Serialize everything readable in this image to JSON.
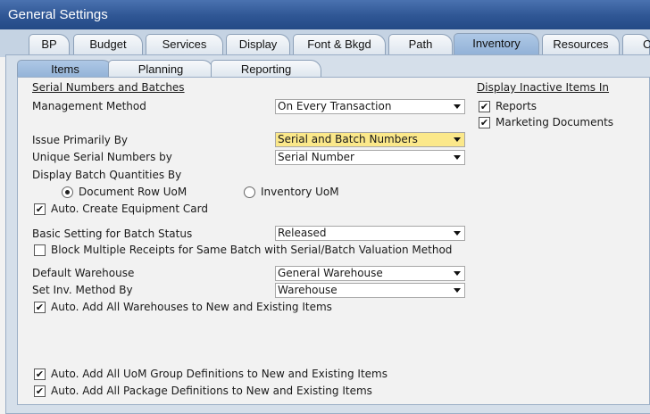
{
  "window": {
    "title": "General Settings"
  },
  "main_tabs": [
    {
      "label": "BP"
    },
    {
      "label": "Budget"
    },
    {
      "label": "Services"
    },
    {
      "label": "Display"
    },
    {
      "label": "Font & Bkgd"
    },
    {
      "label": "Path"
    },
    {
      "label": "Inventory"
    },
    {
      "label": "Resources"
    },
    {
      "label": "Ca"
    }
  ],
  "active_main_tab": "Inventory",
  "sub_tabs": [
    {
      "label": "Items"
    },
    {
      "label": "Planning"
    },
    {
      "label": "Reporting"
    }
  ],
  "active_sub_tab": "Items",
  "serial": {
    "section_title": "Serial Numbers and Batches",
    "management_method": {
      "label": "Management Method",
      "value": "On Every Transaction"
    },
    "issue_primarily_by": {
      "label": "Issue Primarily By",
      "value": "Serial and Batch Numbers"
    },
    "unique_serial_by": {
      "label": "Unique Serial Numbers by",
      "value": "Serial Number"
    },
    "display_batch_qty": {
      "label": "Display Batch Quantities By",
      "options": [
        {
          "label": "Document Row UoM",
          "selected": true
        },
        {
          "label": "Inventory UoM",
          "selected": false
        }
      ]
    },
    "auto_create_equipment": {
      "label": "Auto. Create Equipment Card",
      "checked": true
    },
    "basic_batch_status": {
      "label": "Basic Setting for Batch Status",
      "value": "Released"
    },
    "block_multiple_receipts": {
      "label": "Block Multiple Receipts for Same Batch with Serial/Batch Valuation Method",
      "checked": false
    }
  },
  "warehouse": {
    "default_warehouse": {
      "label": "Default Warehouse",
      "value": "General Warehouse"
    },
    "set_inv_method": {
      "label": "Set Inv. Method By",
      "value": "Warehouse"
    },
    "auto_add_warehouses": {
      "label": "Auto. Add All Warehouses to New and Existing Items",
      "checked": true
    },
    "auto_add_uom_groups": {
      "label": "Auto. Add All UoM Group Definitions to New and Existing Items",
      "checked": true
    },
    "auto_add_package_defs": {
      "label": "Auto. Add All Package Definitions to New and Existing Items",
      "checked": true
    }
  },
  "inactive": {
    "section_title": "Display Inactive Items In",
    "reports": {
      "label": "Reports",
      "checked": true
    },
    "marketing_documents": {
      "label": "Marketing Documents",
      "checked": true
    }
  },
  "icons": {
    "check": "checkmark-icon",
    "dropdown": "chevron-down-icon",
    "radio_selected": "radio-dot-icon"
  },
  "colors": {
    "title_bar": "#2f5694",
    "active_tab": "#9cbbe0",
    "highlight_field": "#fbe88a"
  }
}
